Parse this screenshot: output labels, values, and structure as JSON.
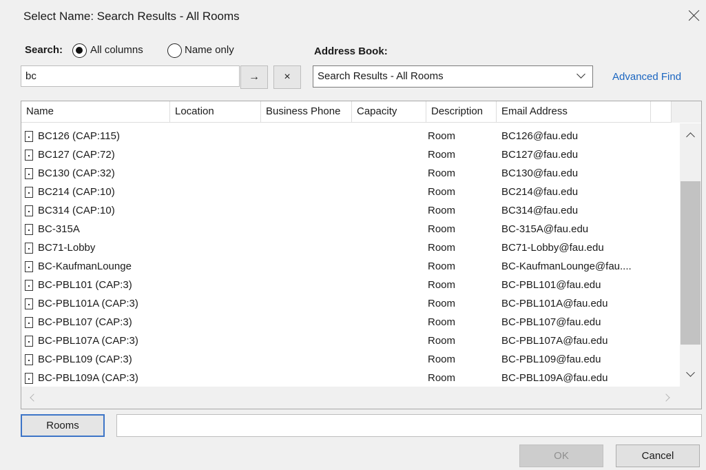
{
  "window": {
    "title": "Select Name: Search Results - All Rooms"
  },
  "search": {
    "label": "Search:",
    "option_all": "All columns",
    "option_name": "Name only",
    "selected": "All columns",
    "value": "bc",
    "go_glyph": "→",
    "clear_glyph": "×"
  },
  "address_book": {
    "label": "Address Book:",
    "selected": "Search Results - All Rooms",
    "advanced_find": "Advanced Find"
  },
  "table": {
    "columns": [
      "Name",
      "Location",
      "Business Phone",
      "Capacity",
      "Description",
      "Email Address"
    ],
    "rows": [
      {
        "name": "BC126 (CAP:115)",
        "location": "",
        "phone": "",
        "capacity": "",
        "description": "Room",
        "email": "BC126@fau.edu"
      },
      {
        "name": "BC127 (CAP:72)",
        "location": "",
        "phone": "",
        "capacity": "",
        "description": "Room",
        "email": "BC127@fau.edu"
      },
      {
        "name": "BC130 (CAP:32)",
        "location": "",
        "phone": "",
        "capacity": "",
        "description": "Room",
        "email": "BC130@fau.edu"
      },
      {
        "name": "BC214 (CAP:10)",
        "location": "",
        "phone": "",
        "capacity": "",
        "description": "Room",
        "email": "BC214@fau.edu"
      },
      {
        "name": "BC314 (CAP:10)",
        "location": "",
        "phone": "",
        "capacity": "",
        "description": "Room",
        "email": "BC314@fau.edu"
      },
      {
        "name": "BC-315A",
        "location": "",
        "phone": "",
        "capacity": "",
        "description": "Room",
        "email": "BC-315A@fau.edu"
      },
      {
        "name": "BC71-Lobby",
        "location": "",
        "phone": "",
        "capacity": "",
        "description": "Room",
        "email": "BC71-Lobby@fau.edu"
      },
      {
        "name": "BC-KaufmanLounge",
        "location": "",
        "phone": "",
        "capacity": "",
        "description": "Room",
        "email": "BC-KaufmanLounge@fau...."
      },
      {
        "name": "BC-PBL101 (CAP:3)",
        "location": "",
        "phone": "",
        "capacity": "",
        "description": "Room",
        "email": "BC-PBL101@fau.edu"
      },
      {
        "name": "BC-PBL101A (CAP:3)",
        "location": "",
        "phone": "",
        "capacity": "",
        "description": "Room",
        "email": "BC-PBL101A@fau.edu"
      },
      {
        "name": "BC-PBL107 (CAP:3)",
        "location": "",
        "phone": "",
        "capacity": "",
        "description": "Room",
        "email": "BC-PBL107@fau.edu"
      },
      {
        "name": "BC-PBL107A (CAP:3)",
        "location": "",
        "phone": "",
        "capacity": "",
        "description": "Room",
        "email": "BC-PBL107A@fau.edu"
      },
      {
        "name": "BC-PBL109 (CAP:3)",
        "location": "",
        "phone": "",
        "capacity": "",
        "description": "Room",
        "email": "BC-PBL109@fau.edu"
      },
      {
        "name": "BC-PBL109A (CAP:3)",
        "location": "",
        "phone": "",
        "capacity": "",
        "description": "Room",
        "email": "BC-PBL109A@fau.edu"
      }
    ]
  },
  "footer": {
    "rooms_button": "Rooms",
    "rooms_value": "",
    "ok": "OK",
    "cancel": "Cancel"
  }
}
